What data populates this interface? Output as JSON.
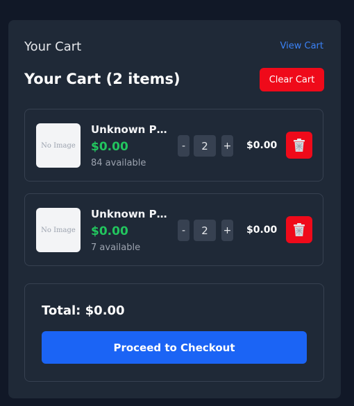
{
  "header": {
    "title": "Your Cart",
    "view_cart_label": "View Cart"
  },
  "cart": {
    "title": "Your Cart (2 items)",
    "clear_label": "Clear Cart",
    "items": [
      {
        "image_placeholder": "No Image",
        "name": "Unknown Pr...",
        "price": "$0.00",
        "available": "84 available",
        "quantity": "2",
        "line_total": "$0.00",
        "minus_label": "-",
        "plus_label": "+"
      },
      {
        "image_placeholder": "No Image",
        "name": "Unknown Pr...",
        "price": "$0.00",
        "available": "7 available",
        "quantity": "2",
        "line_total": "$0.00",
        "minus_label": "-",
        "plus_label": "+"
      }
    ]
  },
  "summary": {
    "total": "Total: $0.00",
    "checkout_label": "Proceed to Checkout"
  },
  "colors": {
    "background": "#111827",
    "panel": "#1f2937",
    "accent_blue": "#1b64f5",
    "link_blue": "#3b82f6",
    "danger_red": "#ef0a1a",
    "price_green": "#22c55e"
  },
  "icons": {
    "delete": "trash-icon"
  }
}
